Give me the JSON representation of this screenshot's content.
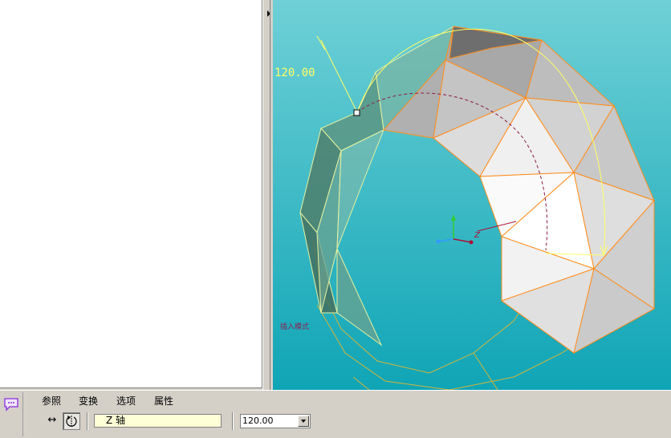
{
  "viewport": {
    "dimension_value": "120.00",
    "axis_label": "Z",
    "mode_text": "插入模式"
  },
  "dashboard": {
    "tabs": [
      "参照",
      "变换",
      "选项",
      "属性"
    ],
    "axis_reference": "Z 轴",
    "angle_value": "120.00"
  },
  "colors": {
    "viewport_background": "#1fb0bf",
    "edge_highlight": "#ff8c1a",
    "preview_outline": "#ffff66",
    "panel_background": "#d4d0c8",
    "axis_field_background": "#ffffd7"
  },
  "icons": [
    "message-icon",
    "direction-arrows-icon",
    "rotation-icon",
    "dropdown-arrow-icon",
    "splitter-arrow-icon"
  ]
}
